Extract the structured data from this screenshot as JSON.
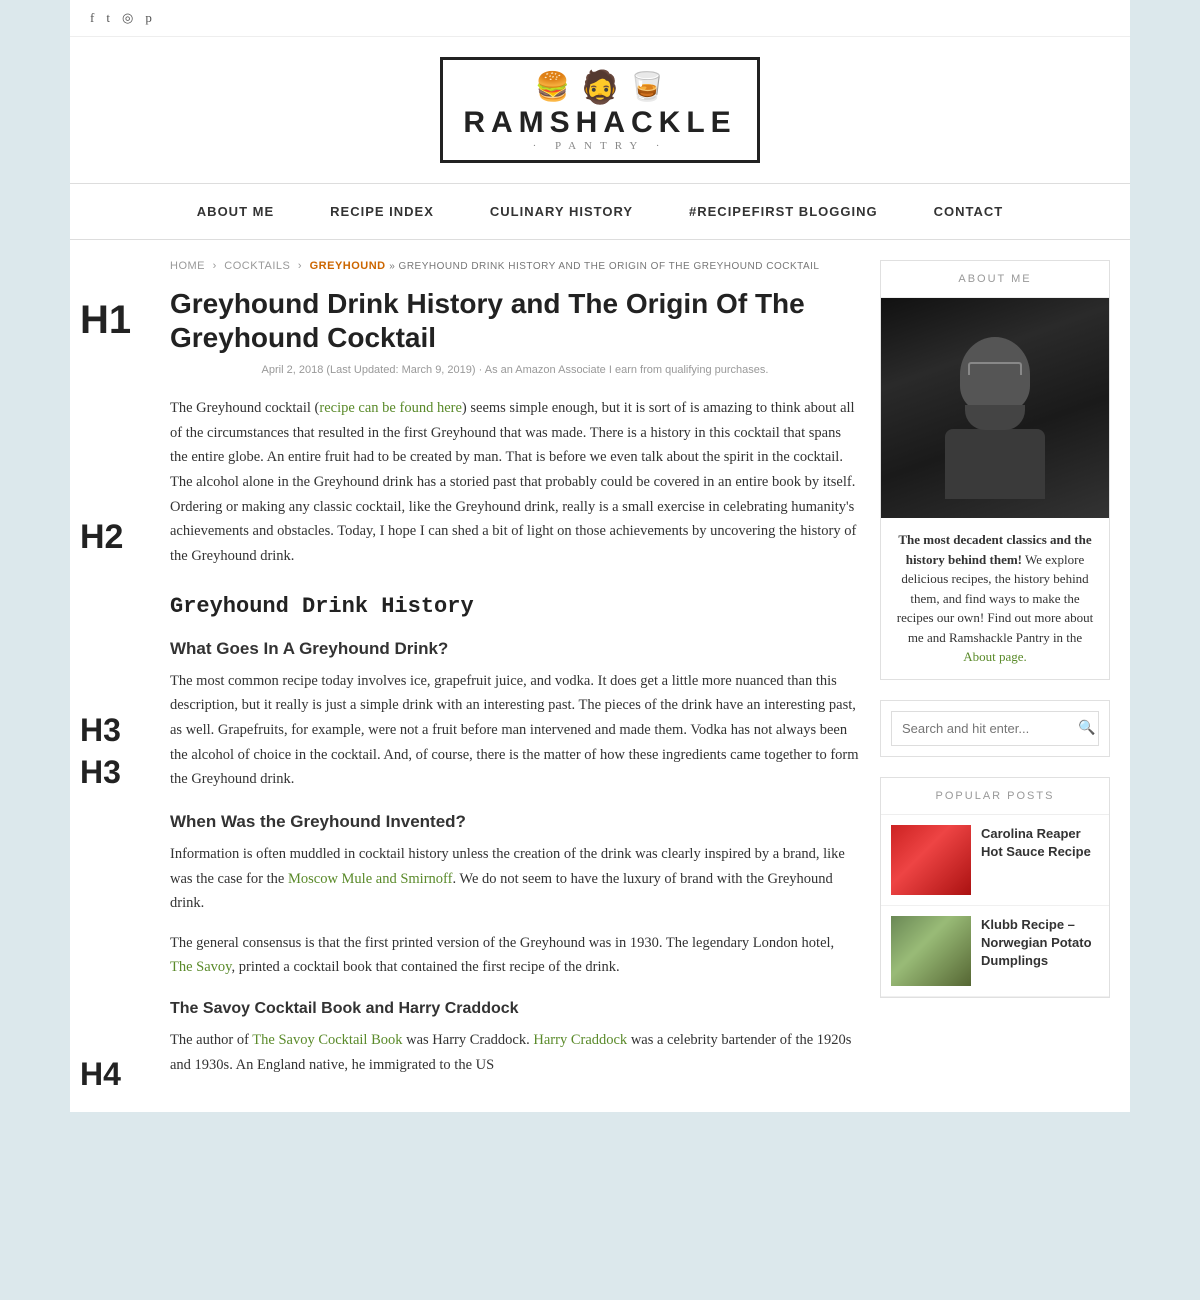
{
  "site": {
    "logo_line1": "RAMSHACKLE",
    "logo_line2": "· PANTRY ·",
    "logo_icons": "🍔 🧔 🥃"
  },
  "social": {
    "icons": [
      "f",
      "t",
      "📷",
      "p"
    ]
  },
  "nav": {
    "items": [
      {
        "label": "ABOUT ME",
        "id": "about-me"
      },
      {
        "label": "RECIPE INDEX",
        "id": "recipe-index"
      },
      {
        "label": "CULINARY HISTORY",
        "id": "culinary-history"
      },
      {
        "label": "#RECIPEFIRST BLOGGING",
        "id": "recipefirst"
      },
      {
        "label": "CONTACT",
        "id": "contact"
      }
    ]
  },
  "breadcrumb": {
    "items": [
      "HOME",
      "COCKTAILS",
      "GREYHOUND"
    ],
    "current": "» Greyhound Drink History and The Origin Of The Greyhound Cocktail"
  },
  "article": {
    "title": "Greyhound Drink History and The Origin Of The Greyhound Cocktail",
    "date": "April 2, 2018 (Last Updated: March 9, 2019) · As an Amazon Associate I earn from qualifying purchases.",
    "intro": "The Greyhound cocktail (recipe can be found here) seems simple enough, but it is sort of is amazing to think about all of the circumstances that resulted in the first Greyhound that was made. There is a history in this cocktail that spans the entire globe. An entire fruit had to be created by man. That is before we even talk about the spirit in the cocktail. The alcohol alone in the Greyhound drink has a storied past that probably could be covered in an entire book by itself. Ordering or making any classic cocktail, like the Greyhound drink, really is a small exercise in celebrating humanity's achievements and obstacles. Today, I hope I can shed a bit of light on those achievements by uncovering the history of the Greyhound drink.",
    "intro_link": "recipe can be found here",
    "h2": "Greyhound Drink History",
    "h3_1": "What Goes In A Greyhound Drink?",
    "p2": "The most common recipe today involves ice, grapefruit juice, and vodka. It does get a little more nuanced than this description, but it really is just a simple drink with an interesting past. The pieces of the drink have an interesting past, as well. Grapefruits, for example, were not a fruit before man intervened and made them. Vodka has not always been the alcohol of choice in the cocktail. And, of course, there is the matter of how these ingredients came together to form the Greyhound drink.",
    "h3_2": "When Was the Greyhound Invented?",
    "p3": "Information is often muddled in cocktail history unless the creation of the drink was clearly inspired by a brand, like was the case for the Moscow Mule and Smirnoff. We do not seem to have the luxury of brand with the Greyhound drink.",
    "p3_link": "Moscow Mule and Smirnoff",
    "p4": "The general consensus is that the first printed version of the Greyhound was in 1930. The legendary London hotel, The Savoy, printed a cocktail book that contained the first recipe of the drink.",
    "p4_link": "The Savoy",
    "h4": "The Savoy Cocktail Book and Harry Craddock",
    "p5": "The author of The Savoy Cocktail Book was Harry Craddock. Harry Craddock was a celebrity bartender of the 1920s and 1930s. An England native, he immigrated to the US",
    "p5_link1": "The Savoy Cocktail Book",
    "p5_link2": "Harry Craddock"
  },
  "sidebar": {
    "about_title": "ABOUT ME",
    "about_text_bold": "The most decadent classics and the history behind them!",
    "about_text": " We explore delicious recipes, the history behind them, and find ways to make the recipes our own! Find out more about me and Ramshackle Pantry in the ",
    "about_link": "About page.",
    "search_placeholder": "Search and hit enter...",
    "popular_title": "POPULAR POSTS",
    "popular_posts": [
      {
        "title": "Carolina Reaper Hot Sauce Recipe",
        "color": "red"
      },
      {
        "title": "Klubb Recipe – Norwegian Potato Dumplings",
        "color": "green"
      }
    ]
  },
  "heading_labels": {
    "h1": "H1",
    "h2": "H2",
    "h3": "H3",
    "h3b": "H3",
    "h4": "H4"
  }
}
